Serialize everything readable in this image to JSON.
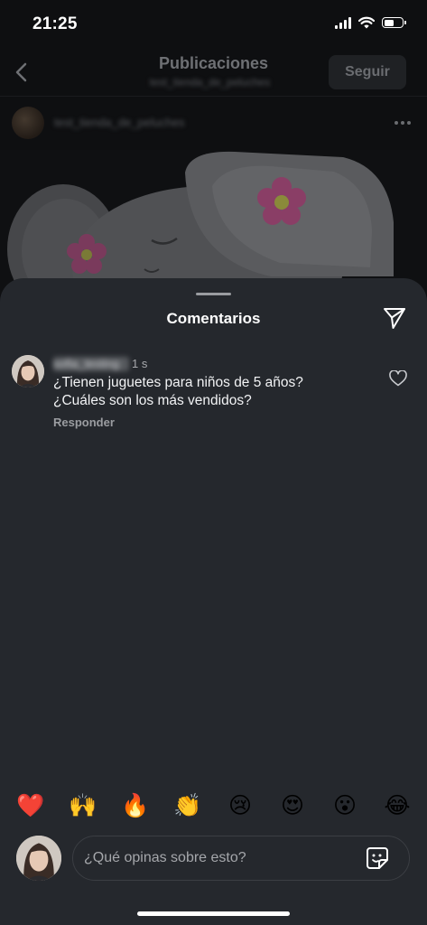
{
  "status_bar": {
    "time": "21:25",
    "icons": [
      "signal-icon",
      "wifi-icon",
      "battery-icon"
    ],
    "battery_level": 0.6
  },
  "post_header": {
    "title": "Publicaciones",
    "subtitle": "test_tienda_de_peluches",
    "follow_label": "Seguir"
  },
  "post_author": {
    "username": "test_tienda_de_peluches"
  },
  "comments_sheet": {
    "title": "Comentarios",
    "comments": [
      {
        "username": "sofia_testing",
        "time": "1 s",
        "text": "¿Tienen juguetes para niños de 5 años? ¿Cuáles son los más vendidos?",
        "reply_label": "Responder"
      }
    ],
    "reactions": [
      "❤️",
      "🙌",
      "🔥",
      "👏",
      "😢",
      "😍",
      "😮",
      "😂"
    ],
    "composer_placeholder": "¿Qué opinas sobre esto?"
  },
  "colors": {
    "sheet_background": "#25282d",
    "page_background": "#0e0f11",
    "text_primary": "#ffffff",
    "text_secondary": "#9b9da1"
  }
}
